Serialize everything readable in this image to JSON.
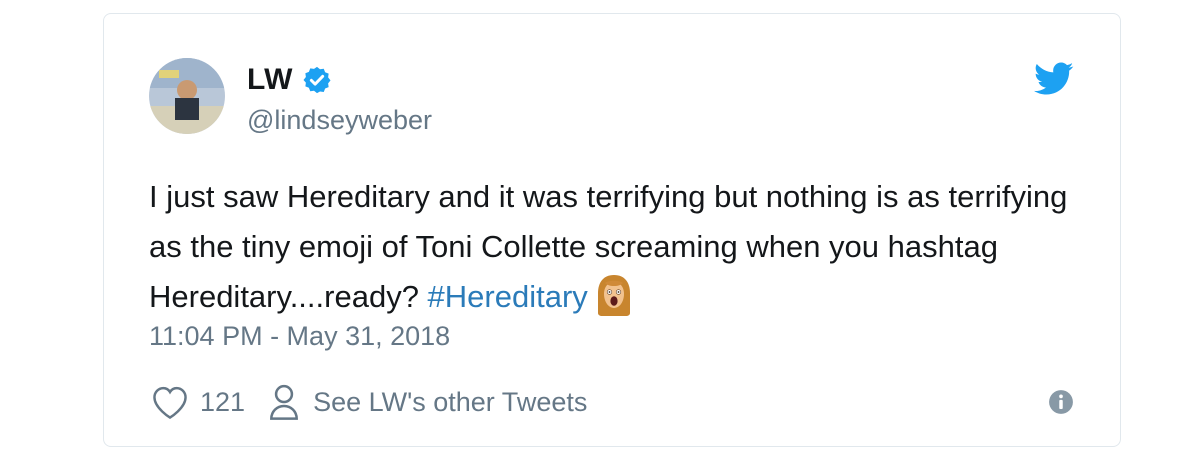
{
  "author": {
    "display_name": "LW",
    "handle": "@lindseyweber",
    "verified_icon": "verified-badge-icon"
  },
  "tweet": {
    "text": "I just saw Hereditary and it was terrifying but nothing is as terrifying as the tiny emoji of Toni Collette screaming when you hashtag Hereditary....ready? ",
    "hashtag": "#Hereditary",
    "emoji": "toni-collette-screaming-emoji-icon",
    "timestamp": "11:04 PM - May 31, 2018"
  },
  "actions": {
    "like_count": "121",
    "profile_link": "See LW's other Tweets"
  },
  "icons": {
    "logo": "twitter-bird-icon",
    "like": "heart-icon",
    "profile": "person-icon",
    "info": "info-icon"
  },
  "colors": {
    "link": "#2b7bb9",
    "verified": "#1da1f2",
    "secondary_text": "#657786",
    "primary_text": "#14171a"
  }
}
